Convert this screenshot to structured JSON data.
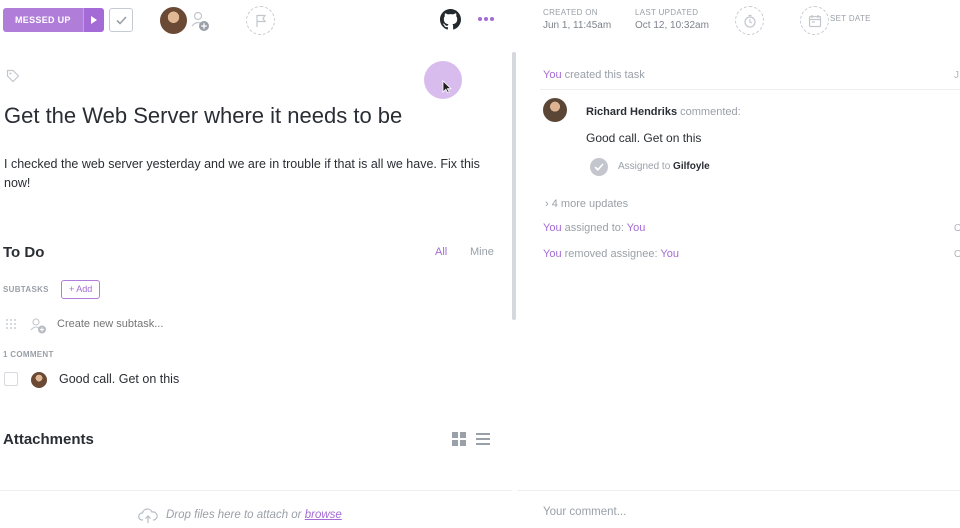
{
  "topbar": {
    "status_label": "MESSED UP",
    "created_label": "CREATED ON",
    "created_value": "Jun 1, 11:45am",
    "updated_label": "LAST UPDATED",
    "updated_value": "Oct 12, 10:32am",
    "set_date_label": "SET DATE",
    "accent_color": "#b07dd9"
  },
  "task": {
    "title": "Get the Web Server where it needs to be",
    "description": "I checked the web server yesterday and we are in trouble if that is all we have. Fix this now!"
  },
  "todo": {
    "title": "To Do",
    "filter_all": "All",
    "filter_mine": "Mine",
    "subtasks_label": "SUBTASKS",
    "add_label": "+ Add",
    "subtask_placeholder": "Create new subtask..."
  },
  "comments": {
    "count_label": "1 COMMENT",
    "items": [
      {
        "text": "Good call. Get on this"
      }
    ]
  },
  "attachments": {
    "title": "Attachments"
  },
  "activity": {
    "created": {
      "you": "You",
      "rest": " created this task",
      "date_fragment": "J"
    },
    "comment": {
      "name": "Richard Hendriks",
      "verb": "commented:",
      "text": "Good call. Get on this",
      "assigned_prefix": "Assigned to",
      "assigned_name": "Gilfoyle"
    },
    "more_updates": "4 more updates",
    "assigned": {
      "you": "You",
      "rest": " assigned to: ",
      "target": "You",
      "date_fragment": "O"
    },
    "removed": {
      "you": "You",
      "rest": " removed assignee: ",
      "target": "You",
      "date_fragment": "O"
    }
  },
  "footer": {
    "drop_text": "Drop files here to attach or ",
    "browse_label": "browse",
    "comment_placeholder": "Your comment..."
  }
}
